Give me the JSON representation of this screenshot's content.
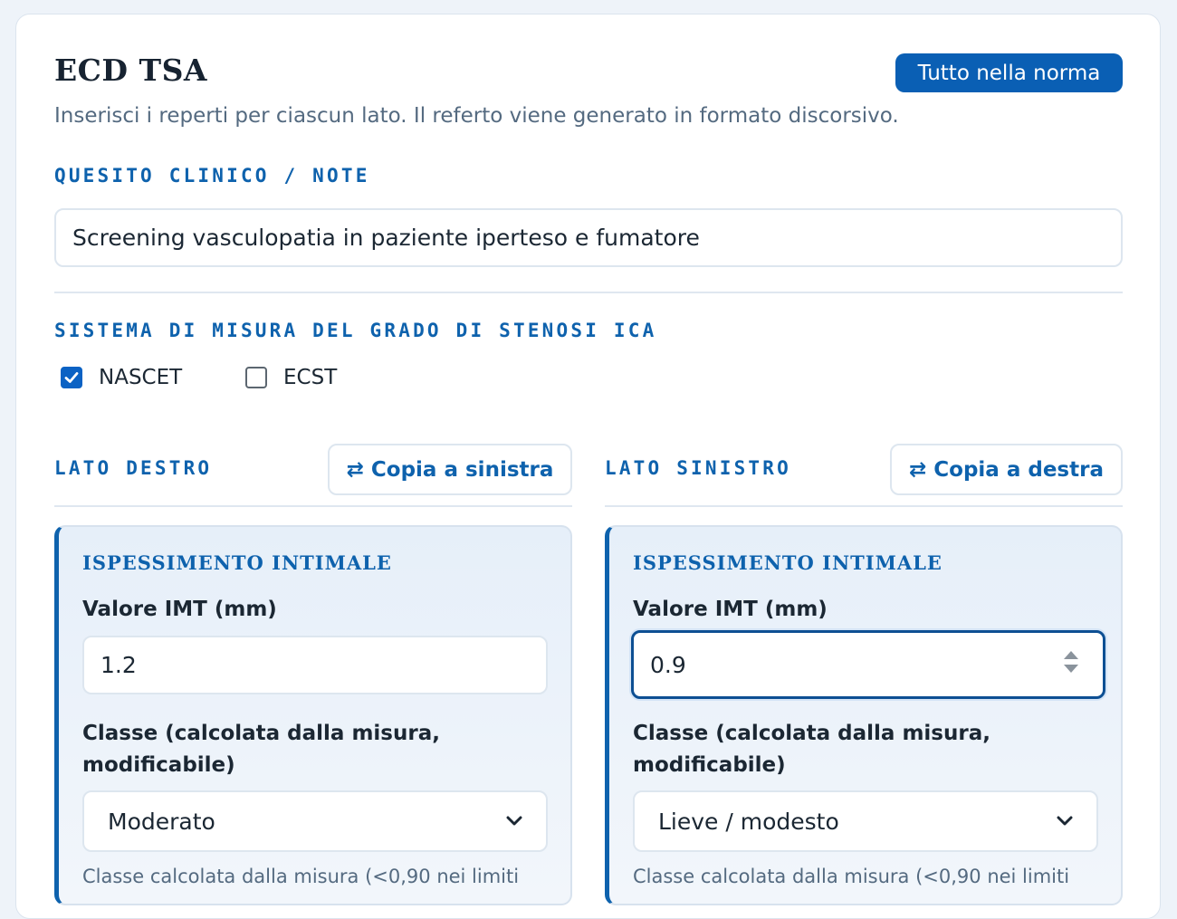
{
  "header": {
    "title": "ECD TSA",
    "primary_button": "Tutto nella norma",
    "subtitle": "Inserisci i reperti per ciascun lato. Il referto viene generato in formato discorsivo."
  },
  "quesito": {
    "label": "QUESITO CLINICO / NOTE",
    "value": "Screening vasculopatia in paziente iperteso e fumatore"
  },
  "sistema": {
    "label": "SISTEMA DI MISURA DEL GRADO DI STENOSI ICA",
    "options": [
      {
        "label": "NASCET",
        "checked": true
      },
      {
        "label": "ECST",
        "checked": false
      }
    ]
  },
  "left_side": {
    "heading": "LATO DESTRO",
    "copy_button": "Copia a sinistra",
    "copy_icon": "⇄",
    "section_title": "ISPESSIMENTO INTIMALE",
    "imt_label": "Valore IMT (mm)",
    "imt_value": "1.2",
    "class_label": "Classe (calcolata dalla misura, modificabile)",
    "class_value": "Moderato",
    "hint": "Classe calcolata dalla misura (<0,90 nei limiti"
  },
  "right_side": {
    "heading": "LATO SINISTRO",
    "copy_button": "Copia a destra",
    "copy_icon": "⇄",
    "section_title": "ISPESSIMENTO INTIMALE",
    "imt_label": "Valore IMT (mm)",
    "imt_value": "0.9",
    "class_label": "Classe (calcolata dalla misura, modificabile)",
    "class_value": "Lieve / modesto",
    "hint": "Classe calcolata dalla misura (<0,90 nei limiti"
  },
  "colors": {
    "accent": "#0e62ad",
    "primary_button": "#0a5fb4",
    "muted_text": "#546a80",
    "panel_bg": "#e6eff9"
  }
}
